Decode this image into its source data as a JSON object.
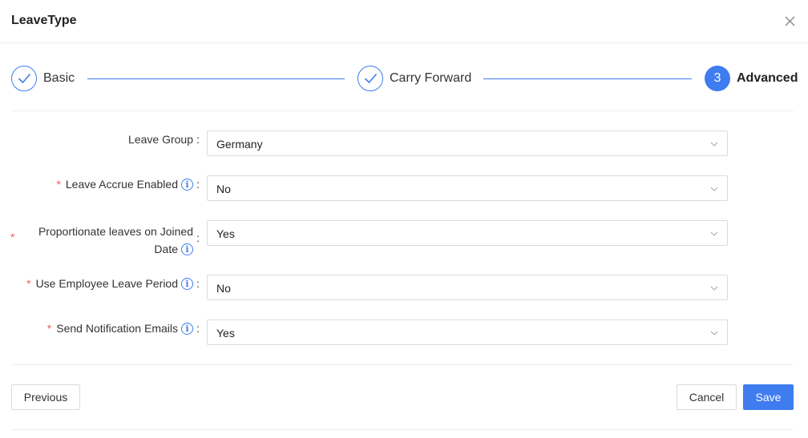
{
  "dialog": {
    "title": "LeaveType"
  },
  "steps": [
    {
      "label": "Basic",
      "state": "done"
    },
    {
      "label": "Carry Forward",
      "state": "done"
    },
    {
      "label": "Advanced",
      "number": "3",
      "state": "active"
    }
  ],
  "form": {
    "leave_group": {
      "label": "Leave Group",
      "value": "Germany"
    },
    "leave_accrue": {
      "label": "Leave Accrue Enabled",
      "value": "No",
      "required": true
    },
    "proportionate": {
      "label_line1": "Proportionate leaves on Joined",
      "label_line2": "Date",
      "value": "Yes",
      "required": true
    },
    "employee_period": {
      "label": "Use Employee Leave Period",
      "value": "No",
      "required": true
    },
    "notification": {
      "label": "Send Notification Emails",
      "value": "Yes",
      "required": true
    },
    "colon": ":",
    "required_mark": "*",
    "info_glyph": "i"
  },
  "buttons": {
    "previous": "Previous",
    "cancel": "Cancel",
    "save": "Save"
  },
  "colors": {
    "accent": "#3f7cf0",
    "required": "#f5555f",
    "border": "#d8dbe2"
  }
}
